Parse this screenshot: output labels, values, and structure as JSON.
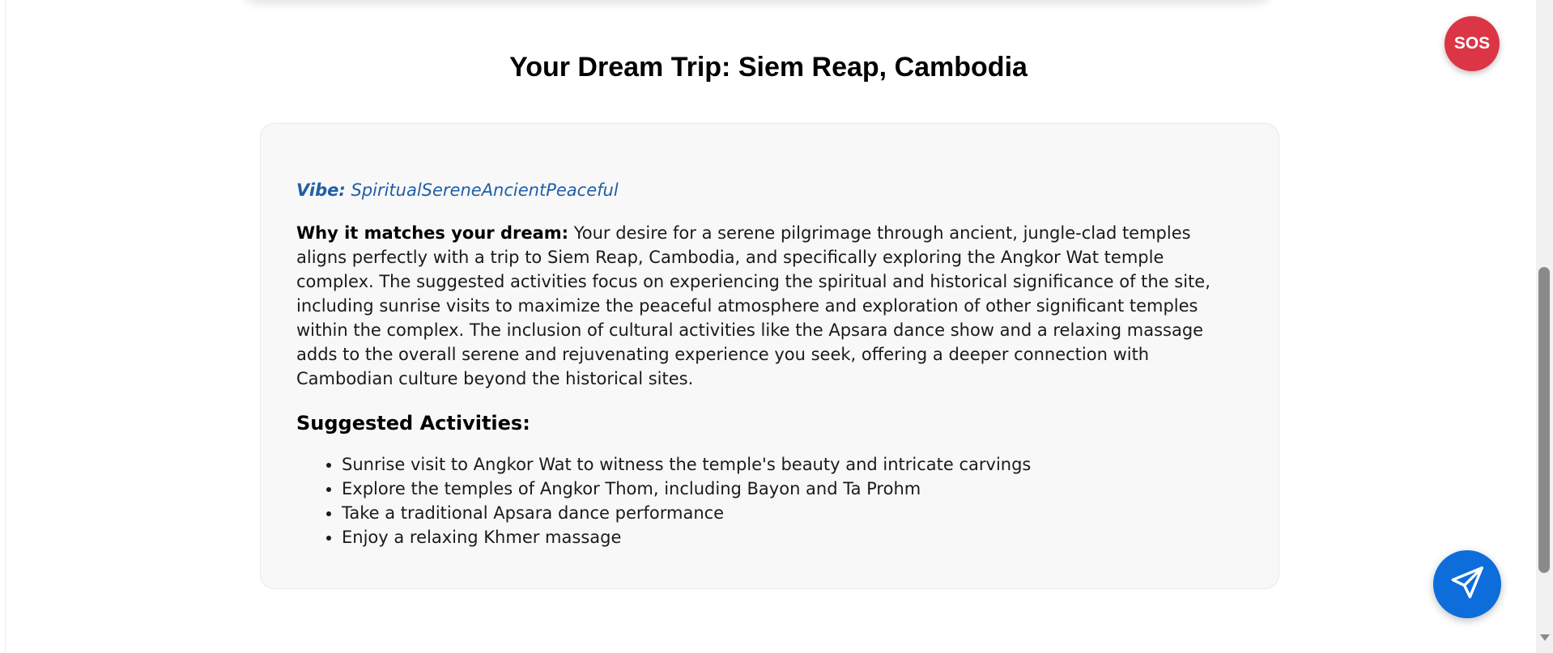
{
  "trip": {
    "title": "Your Dream Trip: Siem Reap, Cambodia",
    "vibe_label": "Vibe:",
    "vibe_value": "SpiritualSereneAncientPeaceful",
    "why_label": "Why it matches your dream:",
    "why_text": "Your desire for a serene pilgrimage through ancient, jungle-clad temples aligns perfectly with a trip to Siem Reap, Cambodia, and specifically exploring the Angkor Wat temple complex. The suggested activities focus on experiencing the spiritual and historical significance of the site, including sunrise visits to maximize the peaceful atmosphere and exploration of other significant temples within the complex. The inclusion of cultural activities like the Apsara dance show and a relaxing massage adds to the overall serene and rejuvenating experience you seek, offering a deeper connection with Cambodian culture beyond the historical sites.",
    "activities_heading": "Suggested Activities:",
    "activities": [
      "Sunrise visit to Angkor Wat to witness the temple's beauty and intricate carvings",
      "Explore the temples of Angkor Thom, including Bayon and Ta Prohm",
      "Take a traditional Apsara dance performance",
      "Enjoy a relaxing Khmer massage"
    ]
  },
  "sos": {
    "label": "SOS",
    "color": "#dc3545"
  },
  "send": {
    "icon": "paper-plane-icon",
    "color": "#0d6ddb"
  },
  "colors": {
    "vibe": "#1f5ea8",
    "card_background": "#f8f8f8"
  }
}
